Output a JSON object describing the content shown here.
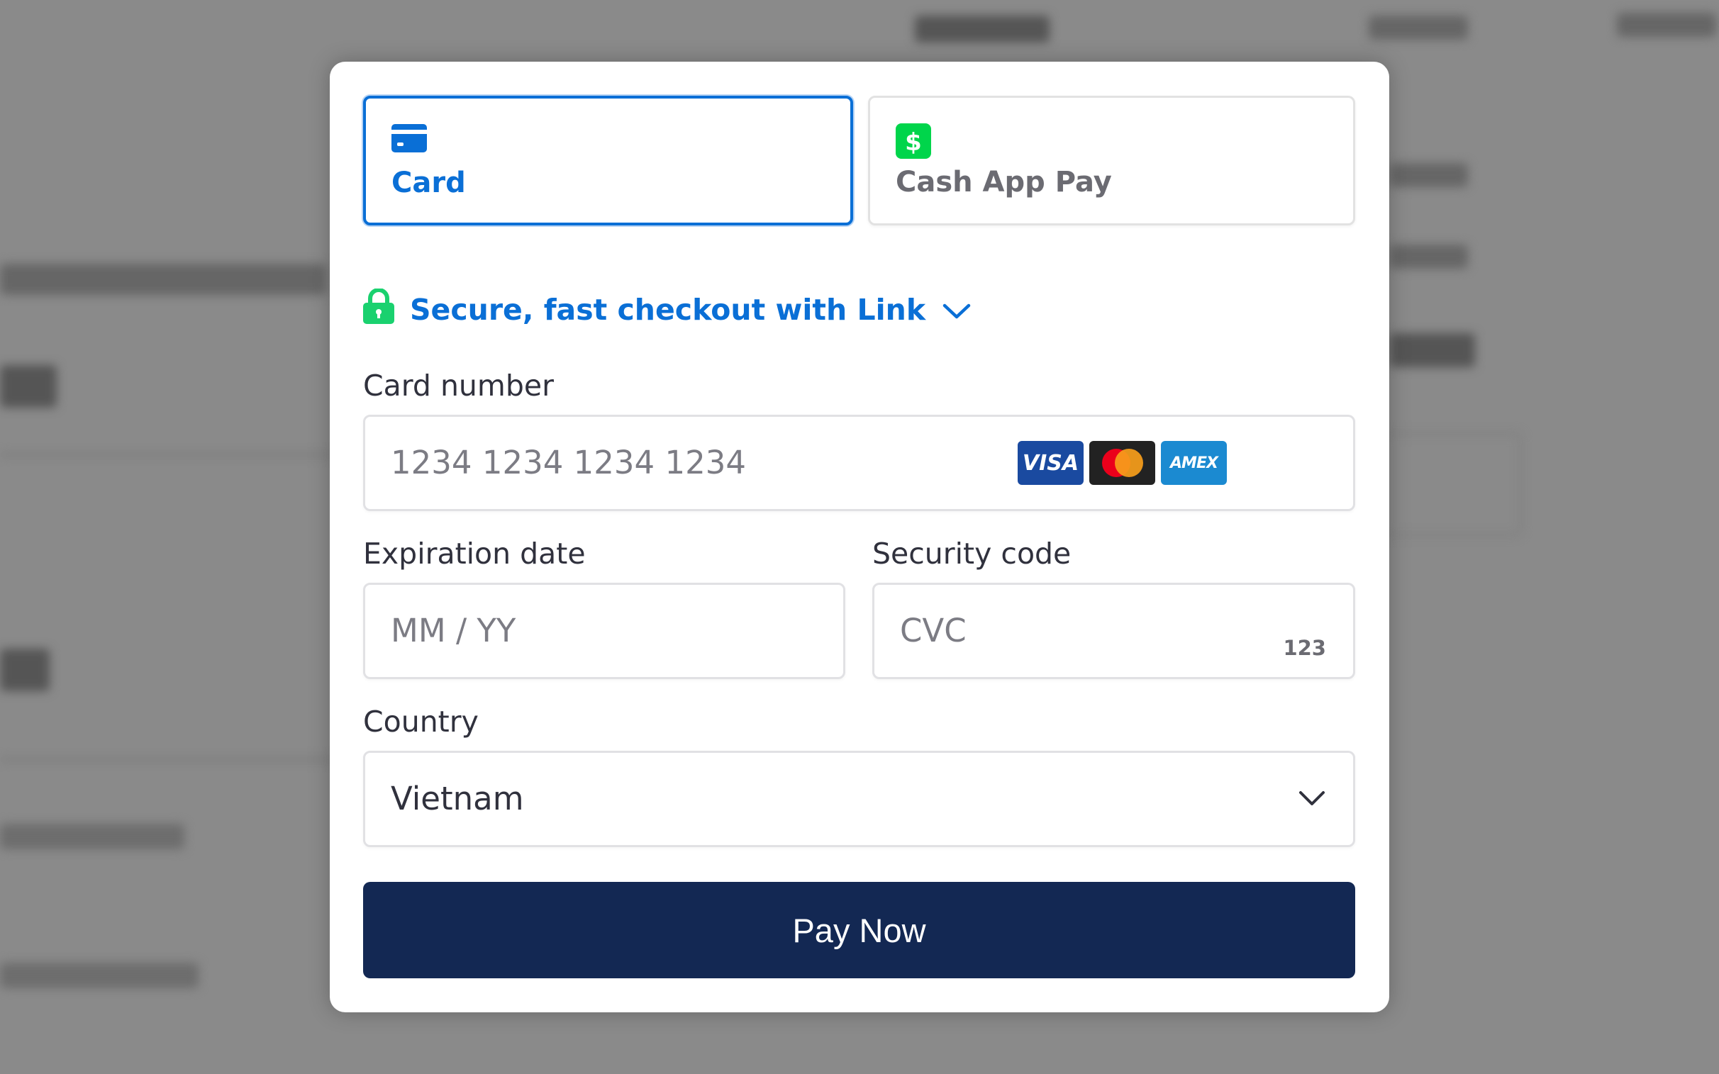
{
  "tabs": [
    {
      "label": "Card",
      "icon": "credit-card-icon",
      "selected": true
    },
    {
      "label": "Cash App Pay",
      "icon": "cash-app-dollar-icon",
      "selected": false
    }
  ],
  "link": {
    "text": "Secure, fast checkout with Link"
  },
  "card_number": {
    "label": "Card number",
    "placeholder": "1234 1234 1234 1234",
    "brands": [
      "VISA",
      "mastercard",
      "AMEX"
    ]
  },
  "expiration": {
    "label": "Expiration date",
    "placeholder": "MM / YY"
  },
  "security": {
    "label": "Security code",
    "placeholder": "CVC",
    "hint": "123"
  },
  "country": {
    "label": "Country",
    "value": "Vietnam"
  },
  "pay_button": {
    "label": "Pay Now"
  },
  "colors": {
    "accent": "#0a6fd6",
    "button": "#132853",
    "cash_app": "#00d54b",
    "lock": "#1ad16f"
  }
}
